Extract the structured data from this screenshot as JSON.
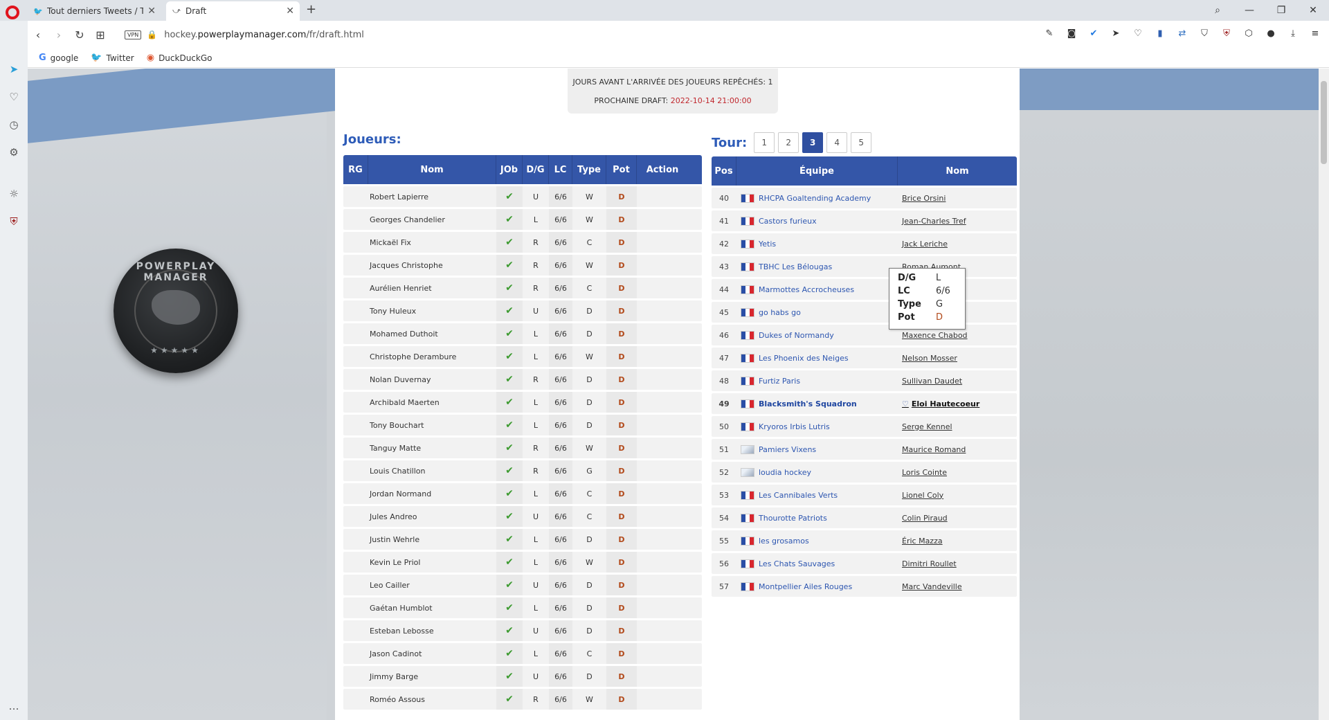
{
  "browser": {
    "tabs": [
      {
        "title": "Tout derniers Tweets / Twitt",
        "icon": "twitter-icon"
      },
      {
        "title": "Draft",
        "icon": "draft-icon"
      }
    ],
    "url_prefix": "hockey.",
    "url_domain": "powerplaymanager.com",
    "url_path": "/fr/draft.html",
    "vpn_label": "VPN",
    "bookmarks": [
      {
        "label": "google",
        "icon": "G"
      },
      {
        "label": "Twitter",
        "icon": "🐦"
      },
      {
        "label": "DuckDuckGo",
        "icon": "◉"
      }
    ]
  },
  "logo_text": "POWERPLAY MANAGER",
  "info": {
    "line1": "JOURS AVANT L'ARRIVÉE DES JOUEURS REPÊCHÉS: 1",
    "line2_label": "PROCHAINE DRAFT: ",
    "line2_value": "2022-10-14 21:00:00"
  },
  "players_title": "Joueurs:",
  "tour_label": "Tour:",
  "tour_buttons": [
    "1",
    "2",
    "3",
    "4",
    "5"
  ],
  "tour_active": "3",
  "players_headers": {
    "rg": "RG",
    "nom": "Nom",
    "job": "JOb",
    "dg": "D/G",
    "lc": "LC",
    "type": "Type",
    "pot": "Pot",
    "action": "Action"
  },
  "players": [
    {
      "nom": "Robert Lapierre",
      "dg": "U",
      "lc": "6/6",
      "type": "W",
      "pot": "D"
    },
    {
      "nom": "Georges Chandelier",
      "dg": "L",
      "lc": "6/6",
      "type": "W",
      "pot": "D"
    },
    {
      "nom": "Mickaël Fix",
      "dg": "R",
      "lc": "6/6",
      "type": "C",
      "pot": "D"
    },
    {
      "nom": "Jacques Christophe",
      "dg": "R",
      "lc": "6/6",
      "type": "W",
      "pot": "D"
    },
    {
      "nom": "Aurélien Henriet",
      "dg": "R",
      "lc": "6/6",
      "type": "C",
      "pot": "D"
    },
    {
      "nom": "Tony Huleux",
      "dg": "U",
      "lc": "6/6",
      "type": "D",
      "pot": "D"
    },
    {
      "nom": "Mohamed Duthoit",
      "dg": "L",
      "lc": "6/6",
      "type": "D",
      "pot": "D"
    },
    {
      "nom": "Christophe Derambure",
      "dg": "L",
      "lc": "6/6",
      "type": "W",
      "pot": "D"
    },
    {
      "nom": "Nolan Duvernay",
      "dg": "R",
      "lc": "6/6",
      "type": "D",
      "pot": "D"
    },
    {
      "nom": "Archibald Maerten",
      "dg": "L",
      "lc": "6/6",
      "type": "D",
      "pot": "D"
    },
    {
      "nom": "Tony Bouchart",
      "dg": "L",
      "lc": "6/6",
      "type": "D",
      "pot": "D"
    },
    {
      "nom": "Tanguy Matte",
      "dg": "R",
      "lc": "6/6",
      "type": "W",
      "pot": "D"
    },
    {
      "nom": "Louis Chatillon",
      "dg": "R",
      "lc": "6/6",
      "type": "G",
      "pot": "D"
    },
    {
      "nom": "Jordan Normand",
      "dg": "L",
      "lc": "6/6",
      "type": "C",
      "pot": "D"
    },
    {
      "nom": "Jules Andreo",
      "dg": "U",
      "lc": "6/6",
      "type": "C",
      "pot": "D"
    },
    {
      "nom": "Justin Wehrle",
      "dg": "L",
      "lc": "6/6",
      "type": "D",
      "pot": "D"
    },
    {
      "nom": "Kevin Le Priol",
      "dg": "L",
      "lc": "6/6",
      "type": "W",
      "pot": "D"
    },
    {
      "nom": "Leo Cailler",
      "dg": "U",
      "lc": "6/6",
      "type": "D",
      "pot": "D"
    },
    {
      "nom": "Gaétan Humblot",
      "dg": "L",
      "lc": "6/6",
      "type": "D",
      "pot": "D"
    },
    {
      "nom": "Esteban Lebosse",
      "dg": "U",
      "lc": "6/6",
      "type": "D",
      "pot": "D"
    },
    {
      "nom": "Jason Cadinot",
      "dg": "L",
      "lc": "6/6",
      "type": "C",
      "pot": "D"
    },
    {
      "nom": "Jimmy Barge",
      "dg": "U",
      "lc": "6/6",
      "type": "D",
      "pot": "D"
    },
    {
      "nom": "Roméo Assous",
      "dg": "R",
      "lc": "6/6",
      "type": "W",
      "pot": "D"
    }
  ],
  "draft_headers": {
    "pos": "Pos",
    "equipe": "Équipe",
    "nom": "Nom"
  },
  "draft": [
    {
      "pos": "40",
      "equipe": "RHCPA Goaltending Academy",
      "nom": "Brice Orsini",
      "flag": "fr"
    },
    {
      "pos": "41",
      "equipe": "Castors furieux",
      "nom": "Jean-Charles Tref",
      "flag": "fr"
    },
    {
      "pos": "42",
      "equipe": "Yetis",
      "nom": "Jack Leriche",
      "flag": "fr"
    },
    {
      "pos": "43",
      "equipe": "TBHC Les Bélougas",
      "nom": "Roman Aumont",
      "flag": "fr"
    },
    {
      "pos": "44",
      "equipe": "Marmottes Accrocheuses",
      "nom": "Quentin Paris",
      "flag": "fr"
    },
    {
      "pos": "45",
      "equipe": "go habs go",
      "nom": "Killian Barros",
      "flag": "fr"
    },
    {
      "pos": "46",
      "equipe": "Dukes of Normandy",
      "nom": "Maxence Chabod",
      "flag": "fr"
    },
    {
      "pos": "47",
      "equipe": "Les Phoenix des Neiges",
      "nom": "Nelson Mosser",
      "flag": "fr"
    },
    {
      "pos": "48",
      "equipe": "Furtiz Paris",
      "nom": "Sullivan Daudet",
      "flag": "fr"
    },
    {
      "pos": "49",
      "equipe": "Blacksmith's Squadron",
      "nom": "Eloi Hautecoeur",
      "flag": "fr",
      "highlight": true
    },
    {
      "pos": "50",
      "equipe": "Kryoros Irbis Lutris",
      "nom": "Serge Kennel",
      "flag": "fr"
    },
    {
      "pos": "51",
      "equipe": "Pamiers Vixens",
      "nom": "Maurice Romand",
      "flag": "plain"
    },
    {
      "pos": "52",
      "equipe": "loudia hockey",
      "nom": "Loris Cointe",
      "flag": "plain"
    },
    {
      "pos": "53",
      "equipe": "Les Cannibales Verts",
      "nom": "Lionel Coly",
      "flag": "fr"
    },
    {
      "pos": "54",
      "equipe": "Thourotte Patriots",
      "nom": "Colin Piraud",
      "flag": "fr"
    },
    {
      "pos": "55",
      "equipe": "les grosamos",
      "nom": "Éric Mazza",
      "flag": "fr"
    },
    {
      "pos": "56",
      "equipe": "Les Chats Sauvages",
      "nom": "Dimitri Roullet",
      "flag": "fr"
    },
    {
      "pos": "57",
      "equipe": "Montpellier Ailes Rouges",
      "nom": "Marc Vandeville",
      "flag": "fr"
    }
  ],
  "tooltip": [
    {
      "k": "D/G",
      "v": "L"
    },
    {
      "k": "LC",
      "v": "6/6"
    },
    {
      "k": "Type",
      "v": "G"
    },
    {
      "k": "Pot",
      "v": "D"
    }
  ],
  "colors": {
    "header_blue": "#3456a8",
    "link_blue": "#2d56b0",
    "pot_orange": "#b24a1b",
    "check_green": "#3c9a2f"
  }
}
